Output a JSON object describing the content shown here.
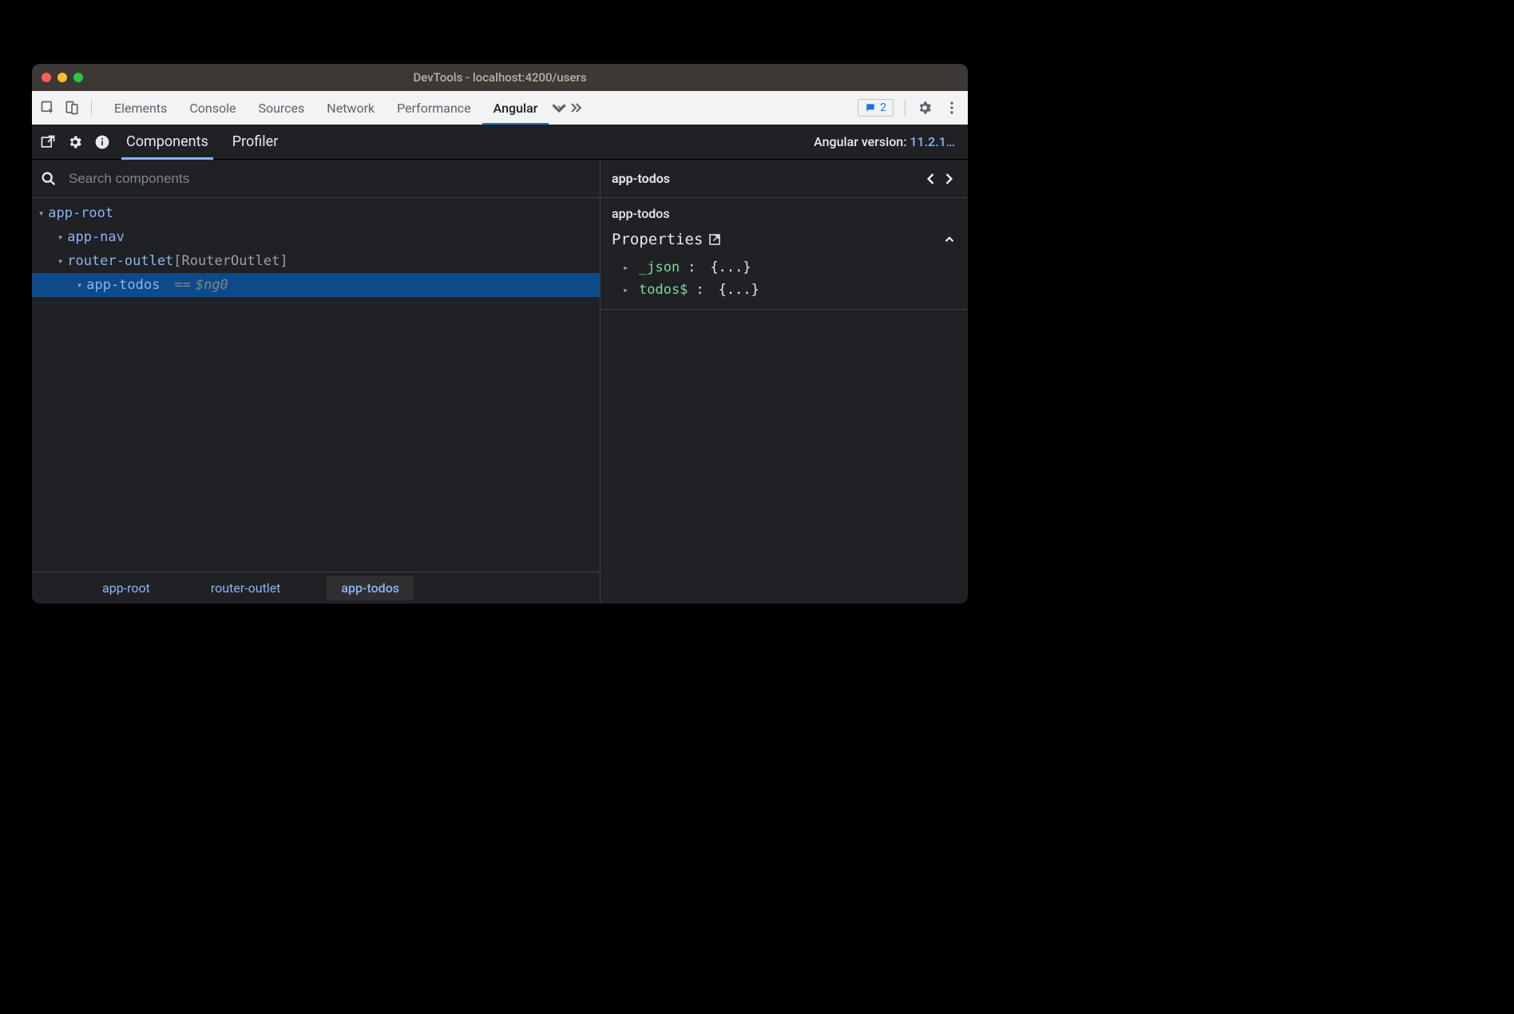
{
  "window": {
    "title": "DevTools - localhost:4200/users"
  },
  "devtools": {
    "tabs": [
      "Elements",
      "Console",
      "Sources",
      "Network",
      "Performance",
      "Angular"
    ],
    "active_tab": 5,
    "badge_count": 2
  },
  "angular_panel": {
    "tabs": [
      "Components",
      "Profiler"
    ],
    "active_tab": 0,
    "version_label": "Angular version:",
    "version_value": "11.2.1…"
  },
  "search": {
    "placeholder": "Search components"
  },
  "tree": {
    "rows": [
      {
        "indent": 0,
        "label": "app-root",
        "selected": false
      },
      {
        "indent": 1,
        "label": "app-nav",
        "selected": false
      },
      {
        "indent": 1,
        "label": "router-outlet",
        "directive": "RouterOutlet",
        "selected": false
      },
      {
        "indent": 2,
        "label": "app-todos",
        "selected": true,
        "eq": "==",
        "var": "$ng0"
      }
    ]
  },
  "breadcrumb": {
    "items": [
      "app-root",
      "router-outlet",
      "app-todos"
    ],
    "active": 2
  },
  "details": {
    "header": "app-todos",
    "subheader": "app-todos",
    "section_title": "Properties",
    "props": [
      {
        "key": "_json",
        "value": "{...}"
      },
      {
        "key": "todos$",
        "value": "{...}"
      }
    ]
  }
}
